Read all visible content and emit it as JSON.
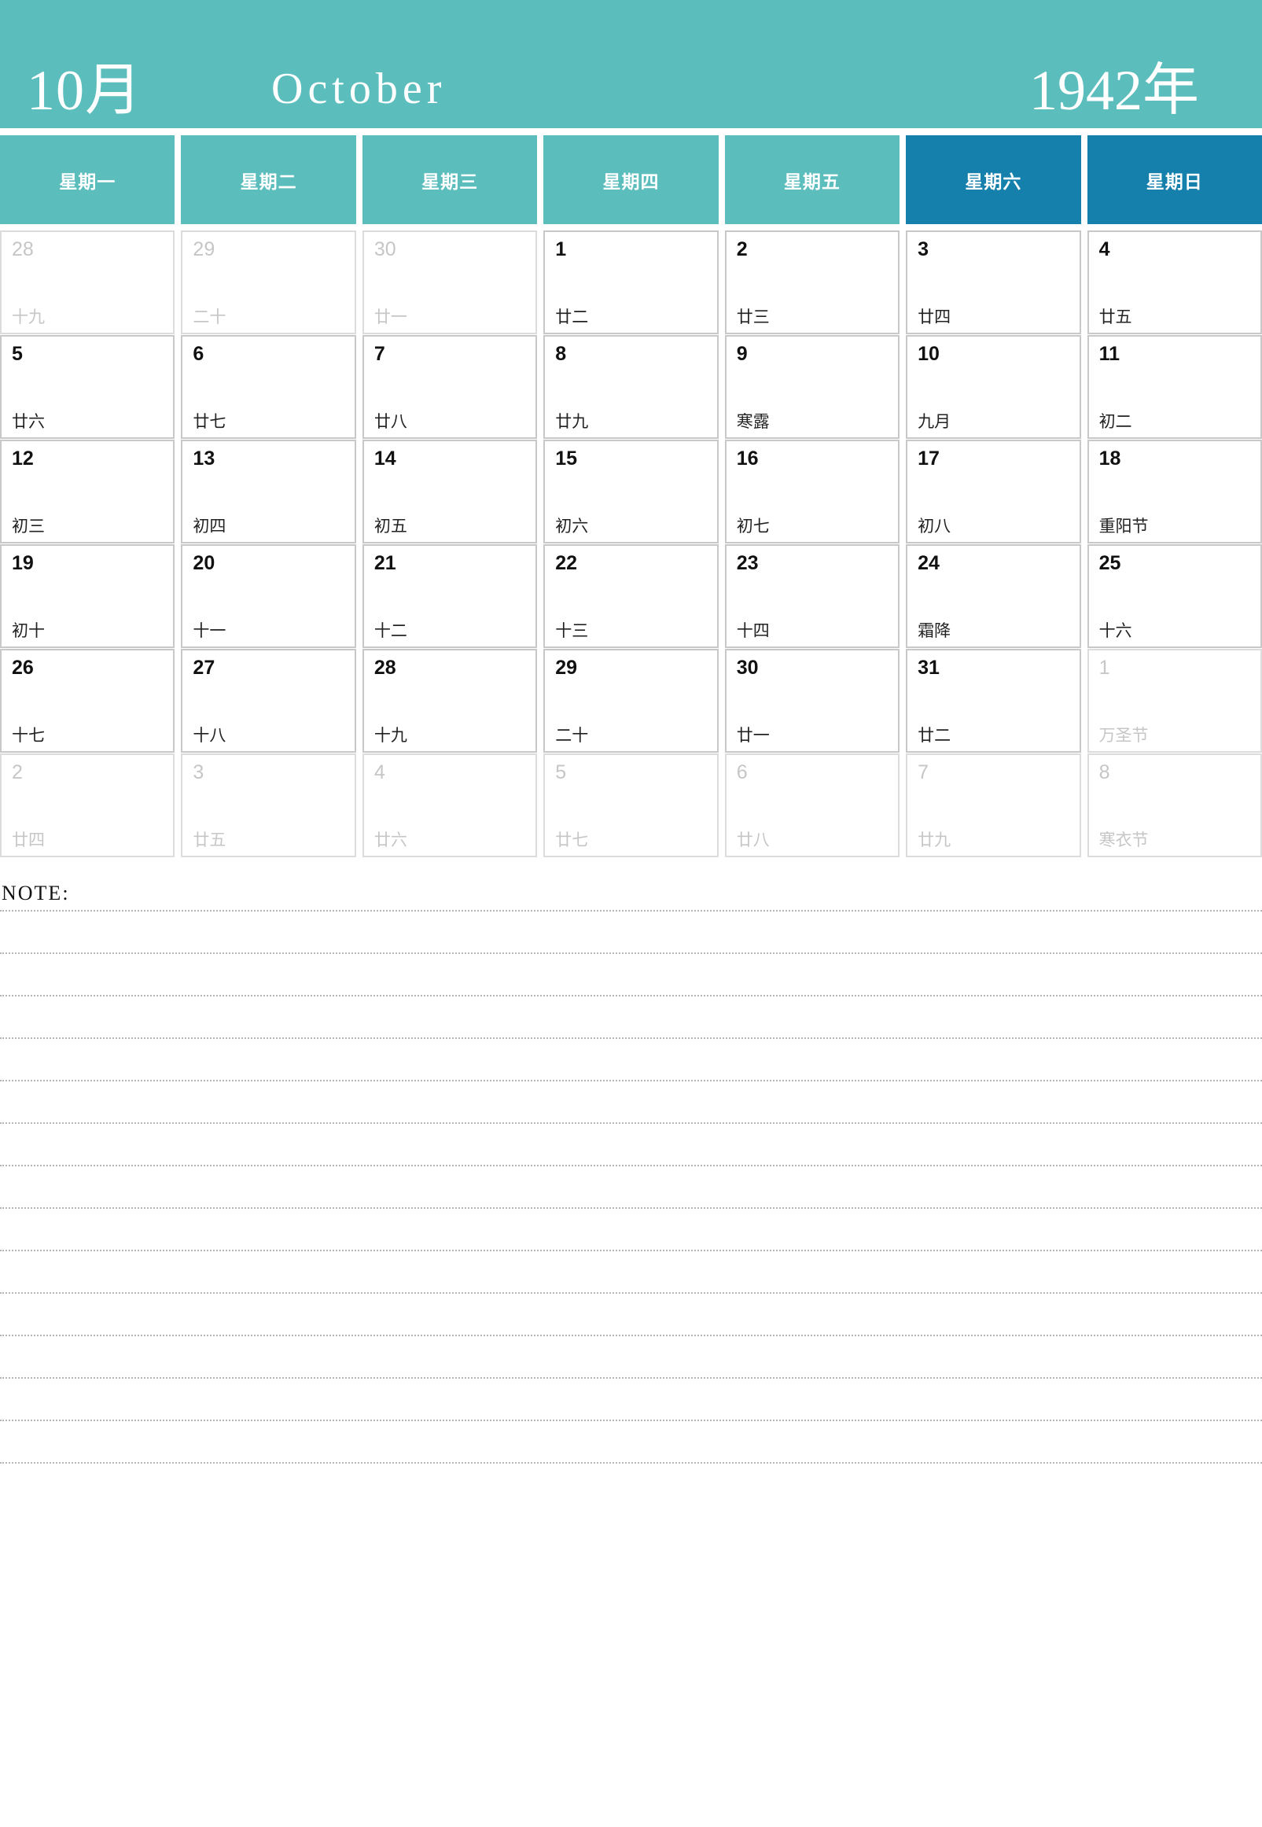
{
  "header": {
    "month_cn": "10月",
    "month_en": "October",
    "year": "1942年",
    "bg_color": "#5cbdbd"
  },
  "weekdays": [
    {
      "label": "星期一",
      "weekend": false
    },
    {
      "label": "星期二",
      "weekend": false
    },
    {
      "label": "星期三",
      "weekend": false
    },
    {
      "label": "星期四",
      "weekend": false
    },
    {
      "label": "星期五",
      "weekend": false
    },
    {
      "label": "星期六",
      "weekend": true
    },
    {
      "label": "星期日",
      "weekend": true
    }
  ],
  "colors": {
    "weekday_bg": "#5cbdbd",
    "weekend_bg": "#1580ac",
    "cell_border": "#c8c8c8",
    "outside_text": "#c6c6c6",
    "text": "#111111"
  },
  "weeks": [
    [
      {
        "num": "28",
        "lunar": "十九",
        "outside": true
      },
      {
        "num": "29",
        "lunar": "二十",
        "outside": true
      },
      {
        "num": "30",
        "lunar": "廿一",
        "outside": true
      },
      {
        "num": "1",
        "lunar": "廿二",
        "outside": false
      },
      {
        "num": "2",
        "lunar": "廿三",
        "outside": false
      },
      {
        "num": "3",
        "lunar": "廿四",
        "outside": false
      },
      {
        "num": "4",
        "lunar": "廿五",
        "outside": false
      }
    ],
    [
      {
        "num": "5",
        "lunar": "廿六",
        "outside": false
      },
      {
        "num": "6",
        "lunar": "廿七",
        "outside": false
      },
      {
        "num": "7",
        "lunar": "廿八",
        "outside": false
      },
      {
        "num": "8",
        "lunar": "廿九",
        "outside": false
      },
      {
        "num": "9",
        "lunar": "寒露",
        "outside": false
      },
      {
        "num": "10",
        "lunar": "九月",
        "outside": false
      },
      {
        "num": "11",
        "lunar": "初二",
        "outside": false
      }
    ],
    [
      {
        "num": "12",
        "lunar": "初三",
        "outside": false
      },
      {
        "num": "13",
        "lunar": "初四",
        "outside": false
      },
      {
        "num": "14",
        "lunar": "初五",
        "outside": false
      },
      {
        "num": "15",
        "lunar": "初六",
        "outside": false
      },
      {
        "num": "16",
        "lunar": "初七",
        "outside": false
      },
      {
        "num": "17",
        "lunar": "初八",
        "outside": false
      },
      {
        "num": "18",
        "lunar": "重阳节",
        "outside": false
      }
    ],
    [
      {
        "num": "19",
        "lunar": "初十",
        "outside": false
      },
      {
        "num": "20",
        "lunar": "十一",
        "outside": false
      },
      {
        "num": "21",
        "lunar": "十二",
        "outside": false
      },
      {
        "num": "22",
        "lunar": "十三",
        "outside": false
      },
      {
        "num": "23",
        "lunar": "十四",
        "outside": false
      },
      {
        "num": "24",
        "lunar": "霜降",
        "outside": false
      },
      {
        "num": "25",
        "lunar": "十六",
        "outside": false
      }
    ],
    [
      {
        "num": "26",
        "lunar": "十七",
        "outside": false
      },
      {
        "num": "27",
        "lunar": "十八",
        "outside": false
      },
      {
        "num": "28",
        "lunar": "十九",
        "outside": false
      },
      {
        "num": "29",
        "lunar": "二十",
        "outside": false
      },
      {
        "num": "30",
        "lunar": "廿一",
        "outside": false
      },
      {
        "num": "31",
        "lunar": "廿二",
        "outside": false
      },
      {
        "num": "1",
        "lunar": "万圣节",
        "outside": true
      }
    ],
    [
      {
        "num": "2",
        "lunar": "廿四",
        "outside": true
      },
      {
        "num": "3",
        "lunar": "廿五",
        "outside": true
      },
      {
        "num": "4",
        "lunar": "廿六",
        "outside": true
      },
      {
        "num": "5",
        "lunar": "廿七",
        "outside": true
      },
      {
        "num": "6",
        "lunar": "廿八",
        "outside": true
      },
      {
        "num": "7",
        "lunar": "廿九",
        "outside": true
      },
      {
        "num": "8",
        "lunar": "寒衣节",
        "outside": true
      }
    ]
  ],
  "note": {
    "label": "NOTE:",
    "line_count": 13
  }
}
